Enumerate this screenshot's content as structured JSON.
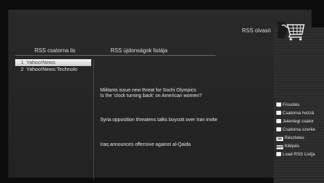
{
  "header": {
    "title": "RSS olvasó"
  },
  "columns": {
    "channels_heading": "RSS csatorna lis",
    "news_heading": "RSS újdonságok listája"
  },
  "channels": [
    {
      "number": "1",
      "label": "Yahoo!News"
    },
    {
      "number": "2",
      "label": "Yahoo!News:Technolo"
    }
  ],
  "news": [
    "Militants issue new threat for Sochi Olympics",
    "Is the 'clock turning back' on American women?",
    "Syria opposition threatens talks boycott over Iran invite",
    "Iraq announces offensive against al-Qaida"
  ],
  "menu": [
    {
      "key": "",
      "label": "Frissítés"
    },
    {
      "key": "",
      "label": "Csatorna hozzá"
    },
    {
      "key": "",
      "label": "Jelenlegi csator"
    },
    {
      "key": "",
      "label": "Csatorna szerke"
    },
    {
      "key": "OK",
      "label": "Részletes"
    },
    {
      "key": "EXIT",
      "label": "Kilépés"
    },
    {
      "key": "",
      "label": "Load RSS List[a"
    }
  ],
  "icons": {
    "cart": "shopping-cart-icon"
  },
  "colors": {
    "background": "#0c0c0c",
    "panel": "#262626",
    "selected_row": "#e6e6e6",
    "text": "#e8e8e8"
  }
}
